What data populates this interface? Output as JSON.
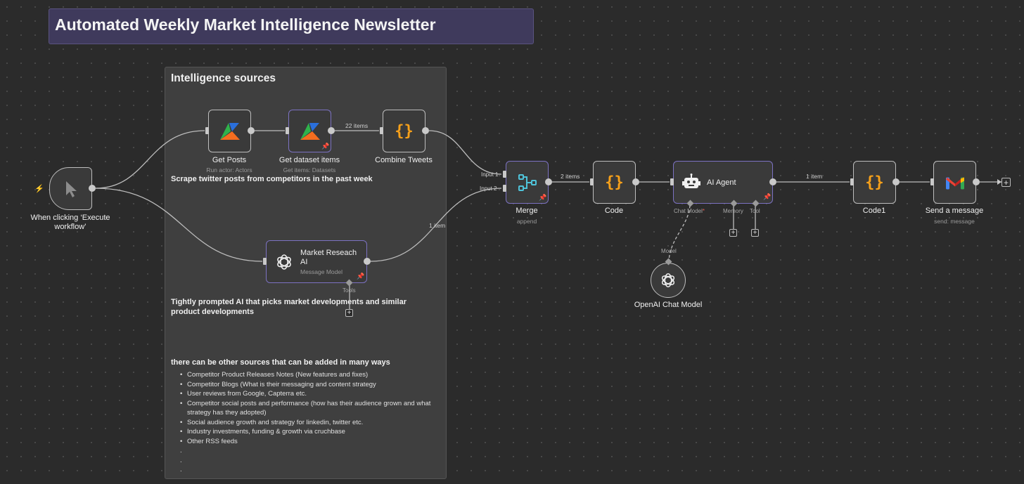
{
  "title": "Automated Weekly Market Intelligence Newsletter",
  "group": {
    "title": "Intelligence sources",
    "note1": "Scrape twitter posts from competitors in the past week",
    "note2": "Tightly prompted AI that picks market developments and similar product developments",
    "note3": "there can be other sources that can be added in many ways",
    "bullets": [
      "Competitor Product Releases Notes (New features and fixes)",
      "Competitor Blogs (What is their messaging and content strategy",
      "User reviews from Google, Capterra etc.",
      "Competitor social posts and performance (how has their audience grown and what strategy has they adopted)",
      "Social audience growth and strategy for linkedin, twitter etc.",
      "Industry investments, funding & growth via cruchbase",
      "Other RSS feeds"
    ],
    "dots": [
      ".",
      ".",
      "."
    ]
  },
  "nodes": {
    "trigger": {
      "label": "When clicking ‘Execute workflow’"
    },
    "get_posts": {
      "label": "Get Posts",
      "sub": "Run actor: Actors"
    },
    "get_dataset": {
      "label": "Get dataset items",
      "sub": "Get items: Datasets"
    },
    "combine": {
      "label": "Combine Tweets"
    },
    "market_ai": {
      "label": "Market Reseach AI",
      "sub": "Message Model",
      "tools": "Tools"
    },
    "merge": {
      "label": "Merge",
      "sub": "append",
      "in1": "Input 1",
      "in2": "Input 2"
    },
    "code": {
      "label": "Code"
    },
    "agent": {
      "label": "AI Agent",
      "chat_model": "Chat Model",
      "required": "*",
      "memory": "Memory",
      "tool": "Tool"
    },
    "openai": {
      "label": "OpenAI Chat Model",
      "model": "Model"
    },
    "code1": {
      "label": "Code1"
    },
    "send": {
      "label": "Send a message",
      "sub": "send: message"
    }
  },
  "edges": {
    "e22": "22 items",
    "e2": "2 items",
    "e1a": "1 item",
    "e1b": "1 item"
  },
  "colors": {
    "apify_green": "#2fb24c",
    "apify_orange": "#f46d1f",
    "apify_blue": "#2a6fdb",
    "code_orange": "#f6a01a",
    "merge_teal": "#4fc3d9",
    "selected": "#7c72c2",
    "trigger_bolt": "#e8584e"
  },
  "icons": {
    "trigger": "cursor-icon",
    "apify": "apify-icon",
    "code": "curly-braces-icon",
    "merge": "merge-icon",
    "openai": "openai-icon",
    "agent": "robot-icon",
    "gmail": "gmail-icon",
    "pin": "pin-icon",
    "bolt": "lightning-icon",
    "plus": "plus-icon"
  }
}
